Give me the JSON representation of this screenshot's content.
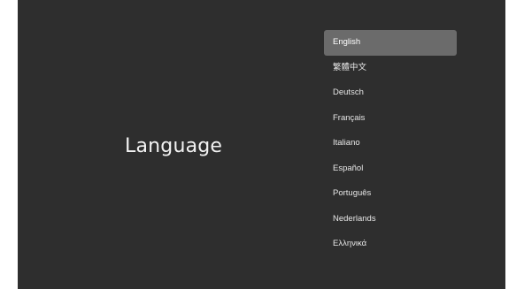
{
  "screen": {
    "title": "Language"
  },
  "languages": {
    "selected_index": 0,
    "items": [
      {
        "label": "English"
      },
      {
        "label": "繁體中文"
      },
      {
        "label": "Deutsch"
      },
      {
        "label": "Français"
      },
      {
        "label": "Italiano"
      },
      {
        "label": "Español"
      },
      {
        "label": "Português"
      },
      {
        "label": "Nederlands"
      },
      {
        "label": "Ελληνικά"
      }
    ]
  },
  "colors": {
    "background": "#2e2e2e",
    "selected_highlight": "#6b6b6b",
    "text": "#e6e6e6"
  }
}
